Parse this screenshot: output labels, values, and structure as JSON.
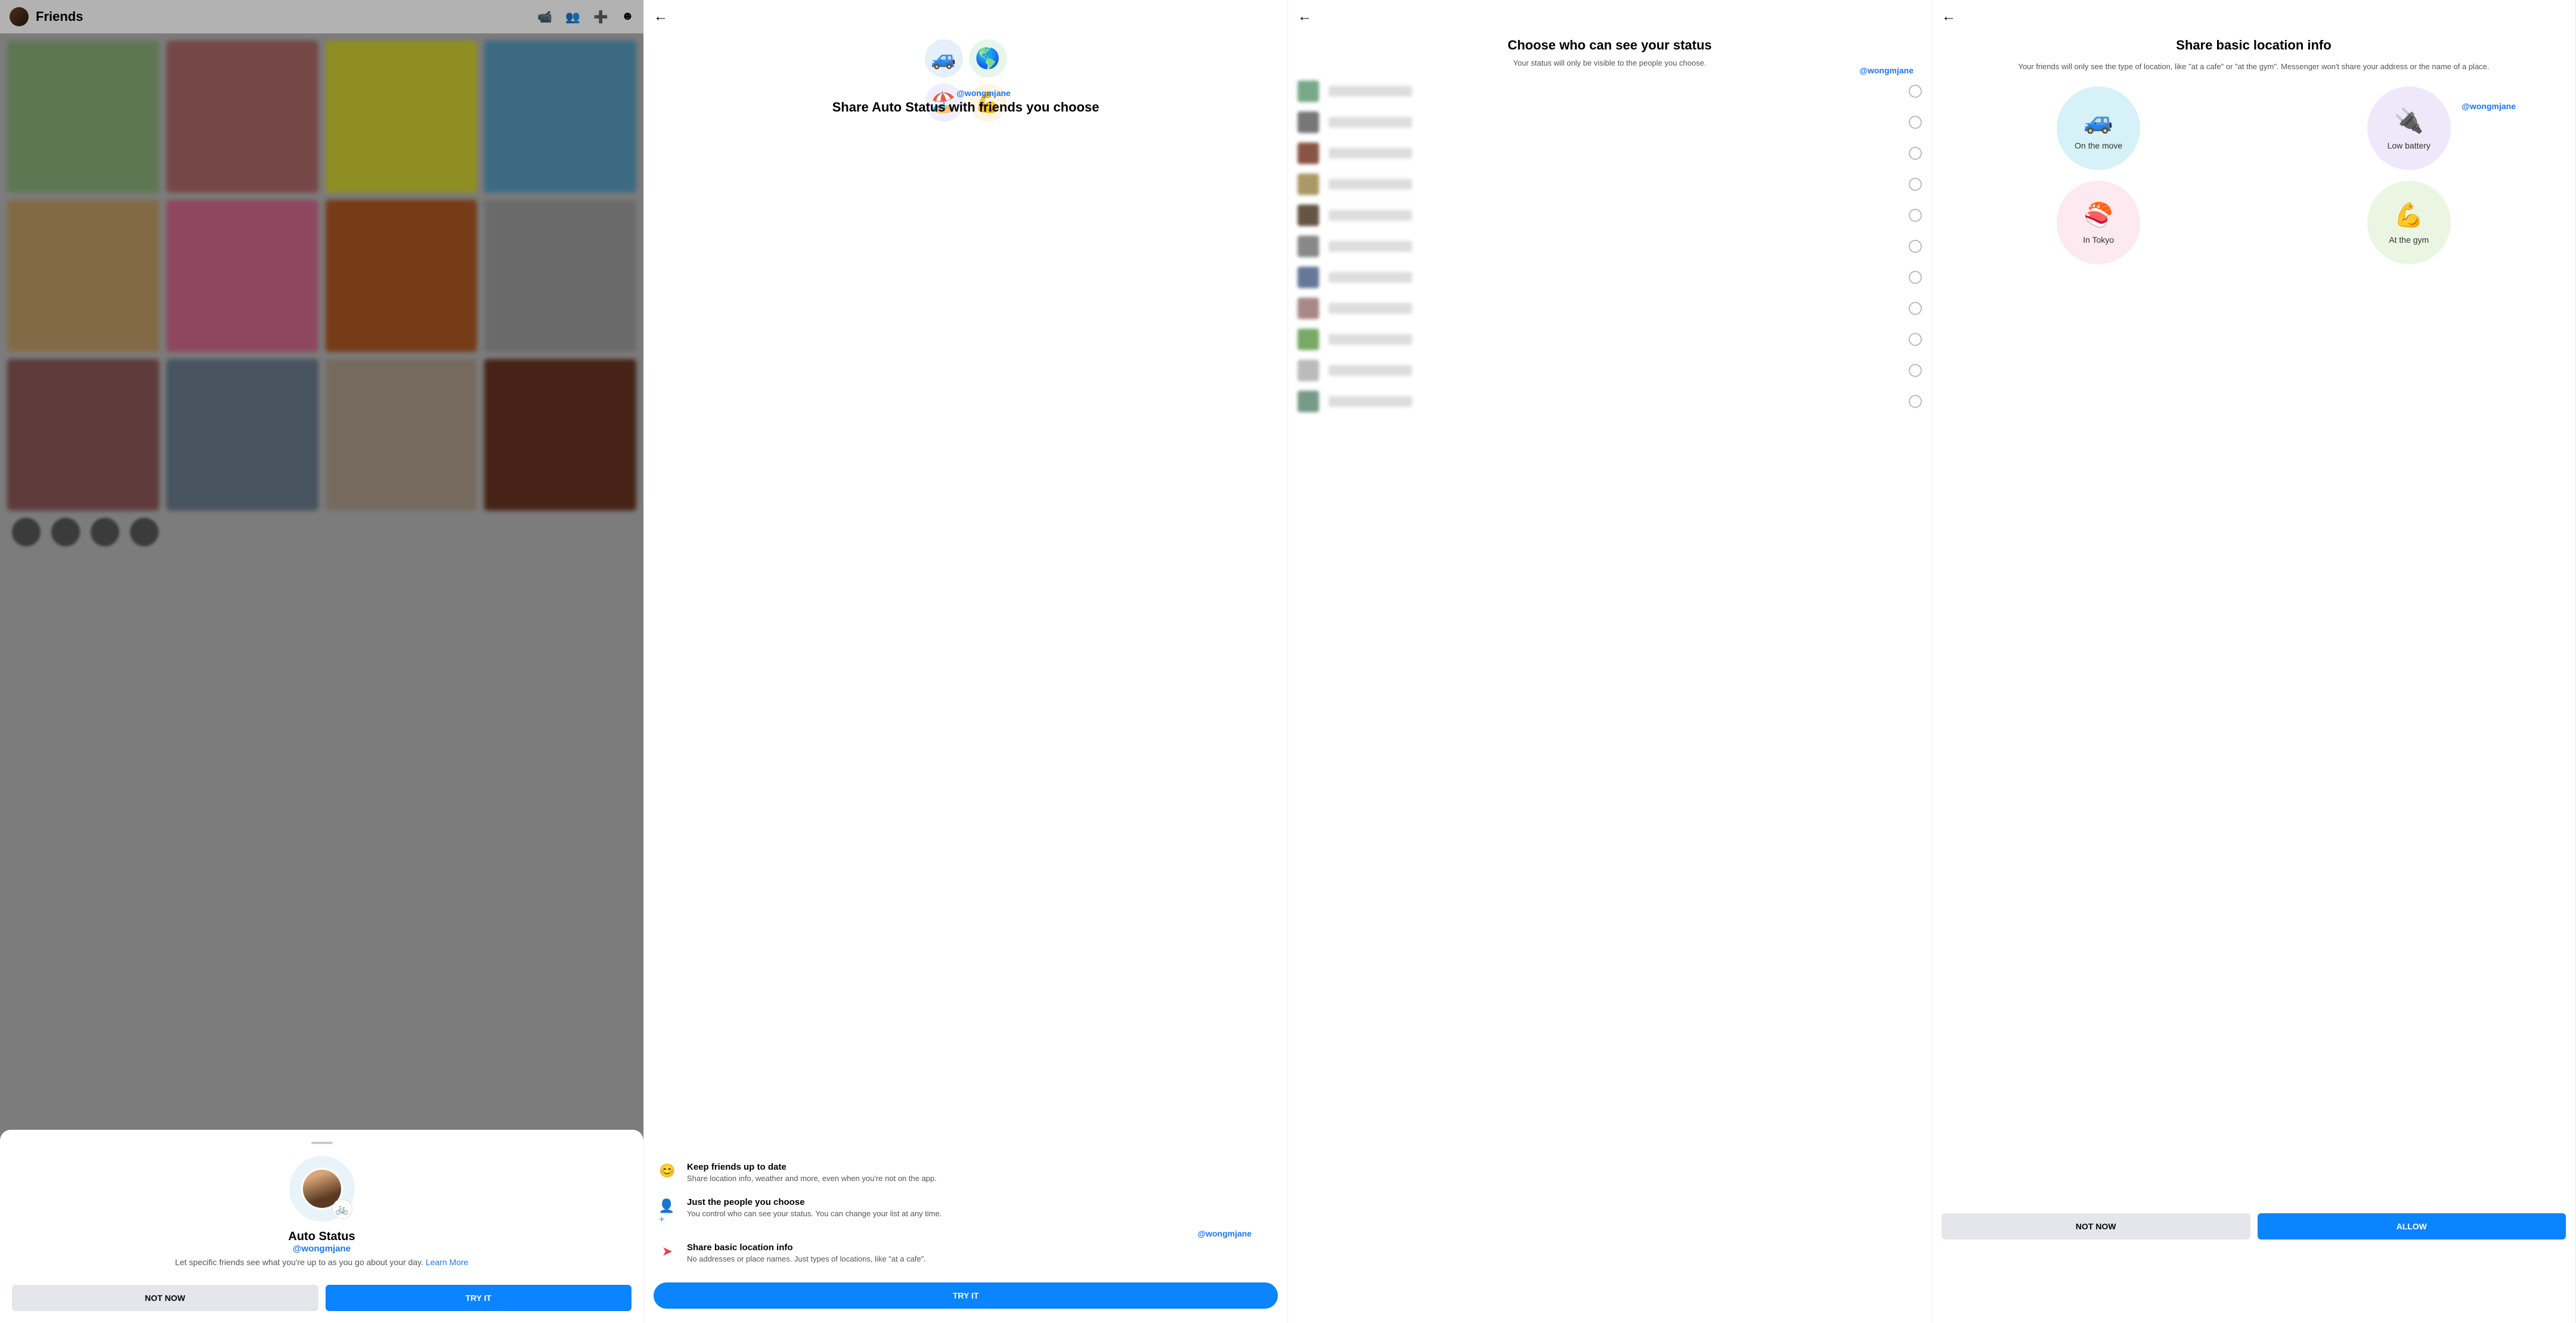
{
  "watermark": "@wongmjane",
  "screen1": {
    "header_title": "Friends",
    "sheet_avatar_emoji": "🚲",
    "sheet_title": "Auto Status",
    "sheet_desc_1": "Let specific friends see what you're up to as you go about your day. ",
    "learn_more": "Learn More",
    "btn_not_now": "NOT NOW",
    "btn_try": "TRY IT"
  },
  "screen2": {
    "hero_emojis": [
      "🚙",
      "🌎",
      "🏖️",
      "💪"
    ],
    "title": "Share Auto Status with friends you choose",
    "btn_try": "TRY IT",
    "features": [
      {
        "icon": "😊",
        "color": "purple",
        "title": "Keep friends up to date",
        "desc": "Share location info, weather and more, even when you're not on the app."
      },
      {
        "icon": "👤⁺",
        "color": "blue",
        "title": "Just the people you choose",
        "desc": "You control who can see your status. You can change your list at any time."
      },
      {
        "icon": "➤",
        "color": "red",
        "title": "Share basic location info",
        "desc": "No addresses or place names. Just types of locations, like \"at a cafe\"."
      }
    ]
  },
  "screen3": {
    "title": "Choose who can see your status",
    "subtitle": "Your status will only be visible to the people you choose.",
    "rows": 11
  },
  "screen4": {
    "title": "Share basic location info",
    "subtitle": "Your friends will only see the type of location, like \"at a cafe\" or \"at the gym\". Messenger won't share your address or the name of a place.",
    "bubbles": [
      {
        "emoji": "🚙",
        "label": "On the move"
      },
      {
        "emoji": "🔌",
        "label": "Low battery"
      },
      {
        "emoji": "🍣",
        "label": "In Tokyo"
      },
      {
        "emoji": "💪",
        "label": "At the gym"
      }
    ],
    "btn_not_now": "NOT NOW",
    "btn_allow": "ALLOW"
  }
}
